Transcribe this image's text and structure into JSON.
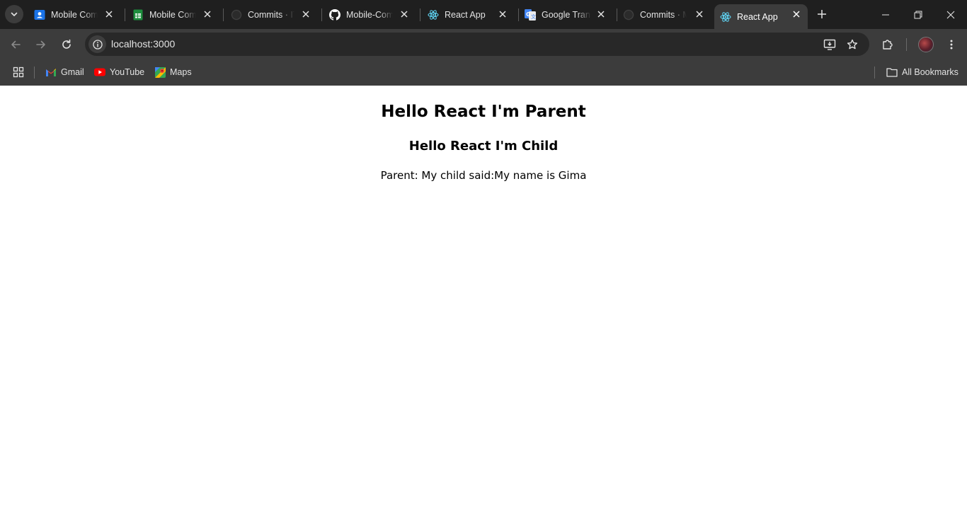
{
  "browser": {
    "tabs": [
      {
        "title": "Mobile Com",
        "icon": "google-contacts-icon"
      },
      {
        "title": "Mobile Com",
        "icon": "google-sheets-icon"
      },
      {
        "title": "Commits · IT",
        "icon": "github-icon"
      },
      {
        "title": "Mobile-Com",
        "icon": "github-icon"
      },
      {
        "title": "React App",
        "icon": "react-icon"
      },
      {
        "title": "Google Trans",
        "icon": "google-translate-icon"
      },
      {
        "title": "Commits · M",
        "icon": "github-icon"
      },
      {
        "title": "React App",
        "icon": "react-icon",
        "active": true
      }
    ],
    "address": {
      "url": "localhost:3000"
    },
    "bookmarks": [
      {
        "label": "Gmail",
        "icon": "gmail-icon"
      },
      {
        "label": "YouTube",
        "icon": "youtube-icon"
      },
      {
        "label": "Maps",
        "icon": "google-maps-icon"
      }
    ],
    "all_bookmarks_label": "All Bookmarks",
    "colors": {
      "tabstrip": "#1f1f1f",
      "toolbar": "#3c3c3c",
      "omnibox": "#282828",
      "text": "#e3e3e3"
    }
  },
  "page": {
    "parent_heading": "Hello React I'm Parent",
    "child_heading": "Hello React I'm Child",
    "message": "Parent: My child said:My name is Gima"
  }
}
